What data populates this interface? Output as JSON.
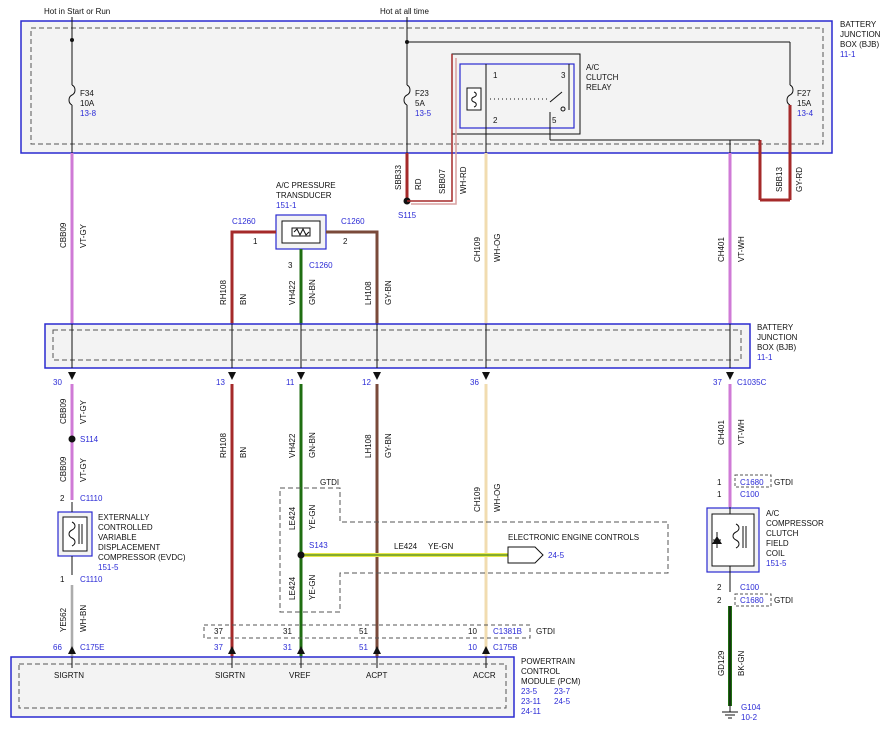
{
  "headers": {
    "hot_run": "Hot in Start or Run",
    "hot_all": "Hot at all time"
  },
  "bjb_top": {
    "name": [
      "BATTERY",
      "JUNCTION",
      "BOX (BJB)"
    ],
    "ref": "11-1"
  },
  "bjb_mid": {
    "name": [
      "BATTERY",
      "JUNCTION",
      "BOX (BJB)"
    ],
    "ref": "11-1"
  },
  "fuses": {
    "f34": {
      "name": "F34",
      "amps": "10A",
      "ref": "13-8"
    },
    "f23": {
      "name": "F23",
      "amps": "5A",
      "ref": "13-5"
    },
    "f27": {
      "name": "F27",
      "amps": "15A",
      "ref": "13-4"
    }
  },
  "relay": {
    "name": [
      "A/C",
      "CLUTCH",
      "RELAY"
    ],
    "pins": [
      "1",
      "2",
      "3",
      "5"
    ]
  },
  "transducer": {
    "name": [
      "A/C PRESSURE",
      "TRANSDUCER"
    ],
    "ref": "151-1",
    "connector": "C1260",
    "pins": [
      "1",
      "2",
      "3"
    ]
  },
  "wires": {
    "cbb09": {
      "circuit": "CBB09",
      "color": "VT-GY"
    },
    "sbb33": {
      "circuit": "SBB33",
      "color": "RD"
    },
    "sbb07": {
      "circuit": "SBB07",
      "color": "WH-RD"
    },
    "sbb13": {
      "circuit": "SBB13",
      "color": "GY-RD"
    },
    "rh108": {
      "circuit": "RH108",
      "color": "BN"
    },
    "vh422": {
      "circuit": "VH422",
      "color": "GN-BN"
    },
    "lh108": {
      "circuit": "LH108",
      "color": "GY-BN"
    },
    "ch109": {
      "circuit": "CH109",
      "color": "WH-OG"
    },
    "ch401": {
      "circuit": "CH401",
      "color": "VT-WH"
    },
    "le424": {
      "circuit": "LE424",
      "color": "YE-GN"
    },
    "ye562": {
      "circuit": "YE562",
      "color": "WH-BN"
    },
    "gd129": {
      "circuit": "GD129",
      "color": "BK-GN"
    }
  },
  "splices": {
    "s115": "S115",
    "s114": "S114",
    "s143": "S143"
  },
  "bjb_pins": [
    "30",
    "13",
    "11",
    "12",
    "36",
    "37"
  ],
  "connectors": {
    "c1035c": "C1035C",
    "c1110": "C1110",
    "c1680": "C1680",
    "c100": "C100",
    "c1381b": "C1381B",
    "c175e": "C175E",
    "c175b": "C175B"
  },
  "gtdi": "GTDI",
  "evdc": {
    "name": [
      "EXTERNALLY",
      "CONTROLLED",
      "VARIABLE",
      "DISPLACEMENT",
      "COMPRESSOR (EVDC)"
    ],
    "ref": "151-5",
    "pin_top": "2",
    "pin_bot": "1"
  },
  "clutch": {
    "name": [
      "A/C",
      "COMPRESSOR",
      "CLUTCH",
      "FIELD",
      "COIL"
    ],
    "ref": "151-5"
  },
  "eec": {
    "name": "ELECTRONIC ENGINE CONTROLS",
    "ref": "24-5"
  },
  "pcm": {
    "name": [
      "POWERTRAIN",
      "CONTROL",
      "MODULE (PCM)"
    ],
    "refs": [
      "23-5",
      "23-7",
      "23-11",
      "24-5",
      "24-11"
    ],
    "pin_labels": [
      "SIGRTN",
      "SIGRTN",
      "VREF",
      "ACPT",
      "ACCR"
    ],
    "pins": [
      "66",
      "37",
      "31",
      "51",
      "10"
    ],
    "gtdi_pins": [
      "37",
      "31",
      "51",
      "10"
    ]
  },
  "ground": {
    "name": "G104",
    "ref": "10-2"
  },
  "colors": {
    "frame": "#2a2ad0",
    "violet": "#cf7ad6",
    "red": "#a52a2a",
    "brown": "#7a4a3a",
    "green": "#1f6e12",
    "yellow": "#e8e84a",
    "cream": "#f1dcb0",
    "black": "#111111"
  }
}
